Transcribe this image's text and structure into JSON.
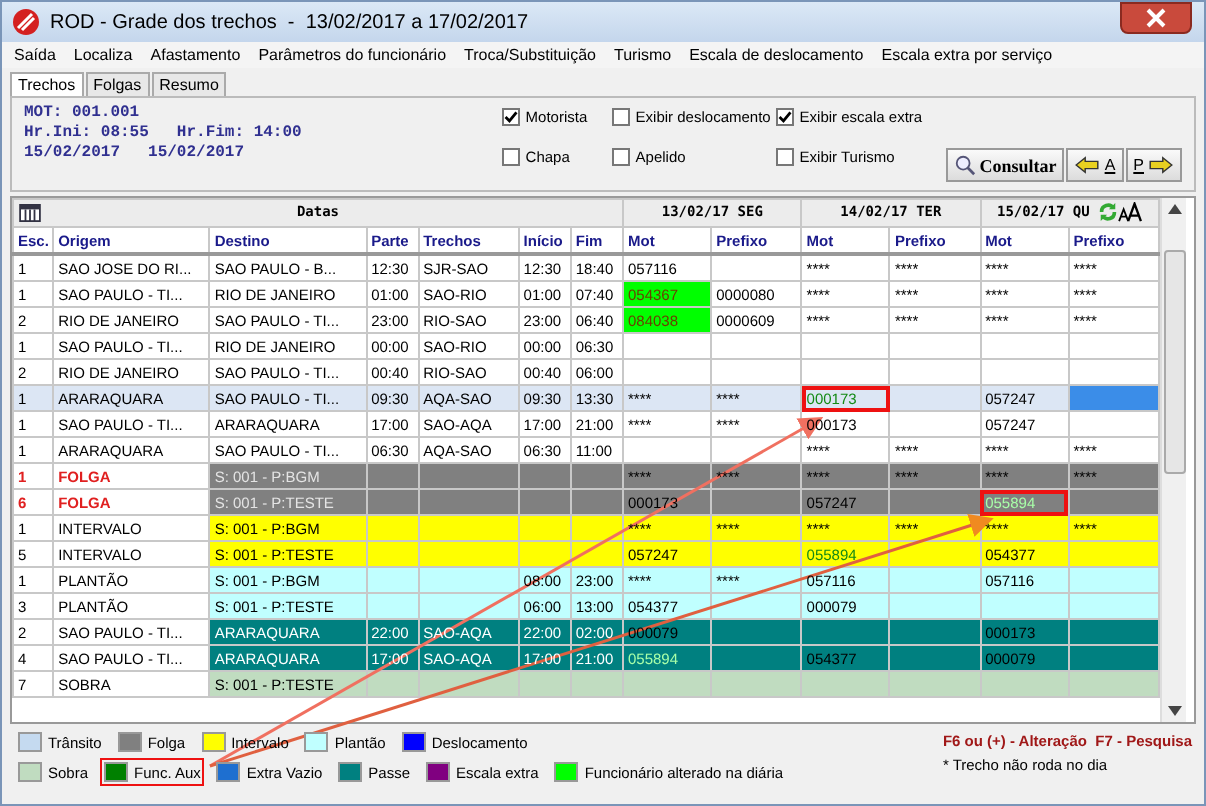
{
  "window": {
    "title": "ROD - Grade dos trechos  -  13/02/2017 a 17/02/2017"
  },
  "menu": [
    "Saída",
    "Localiza",
    "Afastamento",
    "Parâmetros do funcionário",
    "Troca/Substituição",
    "Turismo",
    "Escala de deslocamento",
    "Escala extra por serviço"
  ],
  "tabs": [
    {
      "label": "Trechos",
      "selected": true
    },
    {
      "label": "Folgas",
      "selected": false
    },
    {
      "label": "Resumo",
      "selected": false
    }
  ],
  "info": {
    "lines": [
      [
        "MOT: 001.001"
      ],
      [
        "Hr.Ini: 08:55",
        "Hr.Fim: 14:00"
      ],
      [
        "15/02/2017",
        "15/02/2017"
      ]
    ]
  },
  "options": [
    {
      "label": "Motorista",
      "checked": true
    },
    {
      "label": "Exibir deslocamento",
      "checked": false
    },
    {
      "label": "Exibir escala extra",
      "checked": true
    },
    {
      "label": "Chapa",
      "checked": false
    },
    {
      "label": "Apelido",
      "checked": false
    },
    {
      "label": "Exibir Turismo",
      "checked": false
    }
  ],
  "buttons": {
    "consultar": "Consultar",
    "prev": "A",
    "next": "P"
  },
  "grid": {
    "group_label": "Datas",
    "days": [
      {
        "date": "13/02/17 SEG",
        "columns": [
          "Mot",
          "Prefixo"
        ]
      },
      {
        "date": "14/02/17 TER",
        "columns": [
          "Mot",
          "Prefixo"
        ]
      },
      {
        "date": "15/02/17 QU",
        "columns": [
          "Mot",
          "Prefixo"
        ]
      }
    ],
    "columns": [
      "Esc.",
      "Origem",
      "Destino",
      "Parte",
      "Trechos",
      "Início",
      "Fim"
    ],
    "rows": [
      {
        "kind": "trecho",
        "selected": false,
        "cells": [
          "1",
          "SAO JOSE DO RI...",
          "SAO PAULO - B...",
          "12:30",
          "SJR-SAO",
          "12:30",
          "18:40"
        ],
        "days": [
          {
            "mot": "057116",
            "kind": "normal",
            "marked": false,
            "focused": false
          },
          {
            "mot": "****",
            "prefixo": "****",
            "kind": "normal",
            "marked": false,
            "focused": false
          },
          {
            "mot": "****",
            "prefixo": "****",
            "kind": "normal",
            "marked": false,
            "focused": false
          }
        ]
      },
      {
        "kind": "trecho",
        "selected": false,
        "cells": [
          "1",
          "SAO PAULO - TI...",
          "RIO DE JANEIRO",
          "01:00",
          "SAO-RIO",
          "01:00",
          "07:40"
        ],
        "days": [
          {
            "mot": "054367",
            "prefixo": "0000080",
            "kind": "altered",
            "marked": false,
            "focused": false
          },
          {
            "mot": "****",
            "prefixo": "****",
            "kind": "normal",
            "marked": false,
            "focused": false
          },
          {
            "mot": "****",
            "prefixo": "****",
            "kind": "normal",
            "marked": false,
            "focused": false
          }
        ]
      },
      {
        "kind": "trecho",
        "selected": false,
        "cells": [
          "2",
          "RIO DE JANEIRO",
          "SAO PAULO - TI...",
          "23:00",
          "RIO-SAO",
          "23:00",
          "06:40"
        ],
        "days": [
          {
            "mot": "084038",
            "prefixo": "0000609",
            "kind": "altered",
            "marked": false,
            "focused": false
          },
          {
            "mot": "****",
            "prefixo": "****",
            "kind": "normal",
            "marked": false,
            "focused": false
          },
          {
            "mot": "****",
            "prefixo": "****",
            "kind": "normal",
            "marked": false,
            "focused": false
          }
        ]
      },
      {
        "kind": "trecho",
        "selected": false,
        "cells": [
          "1",
          "SAO PAULO - TI...",
          "RIO DE JANEIRO",
          "00:00",
          "SAO-RIO",
          "00:00",
          "06:30"
        ],
        "days": [
          {
            "kind": "normal",
            "marked": false,
            "focused": false
          },
          {
            "kind": "normal",
            "marked": false,
            "focused": false
          },
          {
            "kind": "normal",
            "marked": false,
            "focused": false
          }
        ]
      },
      {
        "kind": "trecho",
        "selected": false,
        "cells": [
          "2",
          "RIO DE JANEIRO",
          "SAO PAULO - TI...",
          "00:40",
          "RIO-SAO",
          "00:40",
          "06:00"
        ],
        "days": [
          {
            "kind": "normal",
            "marked": false,
            "focused": false
          },
          {
            "kind": "normal",
            "marked": false,
            "focused": false
          },
          {
            "kind": "normal",
            "marked": false,
            "focused": false
          }
        ]
      },
      {
        "kind": "trecho",
        "selected": true,
        "cells": [
          "1",
          "ARARAQUARA",
          "SAO PAULO - TI...",
          "09:30",
          "AQA-SAO",
          "09:30",
          "13:30"
        ],
        "days": [
          {
            "mot": "****",
            "prefixo": "****",
            "kind": "normal",
            "marked": false,
            "focused": false
          },
          {
            "mot": "000173",
            "kind": "aux",
            "marked": true,
            "focused": false
          },
          {
            "mot": "057247",
            "kind": "normal",
            "marked": false,
            "focused": true
          }
        ]
      },
      {
        "kind": "trecho",
        "selected": false,
        "cells": [
          "1",
          "SAO PAULO - TI...",
          "ARARAQUARA",
          "17:00",
          "SAO-AQA",
          "17:00",
          "21:00"
        ],
        "days": [
          {
            "mot": "****",
            "prefixo": "****",
            "kind": "normal",
            "marked": false,
            "focused": false
          },
          {
            "mot": "000173",
            "kind": "normal",
            "marked": false,
            "focused": false
          },
          {
            "mot": "057247",
            "kind": "normal",
            "marked": false,
            "focused": false
          }
        ]
      },
      {
        "kind": "trecho",
        "selected": false,
        "cells": [
          "1",
          "ARARAQUARA",
          "SAO PAULO - TI...",
          "06:30",
          "AQA-SAO",
          "06:30",
          "11:00"
        ],
        "days": [
          {
            "kind": "normal",
            "marked": false,
            "focused": false
          },
          {
            "mot": "****",
            "prefixo": "****",
            "kind": "normal",
            "marked": false,
            "focused": false
          },
          {
            "mot": "****",
            "prefixo": "****",
            "kind": "normal",
            "marked": false,
            "focused": false
          }
        ]
      },
      {
        "kind": "folga",
        "selected": false,
        "cells": [
          "1",
          "FOLGA",
          "S: 001 - P:BGM"
        ],
        "days": [
          {
            "mot": "****",
            "prefixo": "****",
            "kind": "normal",
            "marked": false,
            "focused": false
          },
          {
            "mot": "****",
            "prefixo": "****",
            "kind": "normal",
            "marked": false,
            "focused": false
          },
          {
            "mot": "****",
            "prefixo": "****",
            "kind": "normal",
            "marked": false,
            "focused": false
          }
        ]
      },
      {
        "kind": "folga",
        "selected": false,
        "cells": [
          "6",
          "FOLGA",
          "S: 001 - P:TESTE"
        ],
        "days": [
          {
            "mot": "000173",
            "kind": "normal",
            "marked": false,
            "focused": false
          },
          {
            "mot": "057247",
            "kind": "normal",
            "marked": false,
            "focused": false
          },
          {
            "mot": "055894",
            "kind": "aux",
            "marked": true,
            "focused": false
          }
        ]
      },
      {
        "kind": "intervalo",
        "selected": false,
        "cells": [
          "1",
          "INTERVALO",
          "S: 001 - P:BGM"
        ],
        "days": [
          {
            "mot": "****",
            "prefixo": "****",
            "kind": "normal",
            "marked": false,
            "focused": false
          },
          {
            "mot": "****",
            "prefixo": "****",
            "kind": "normal",
            "marked": false,
            "focused": false
          },
          {
            "mot": "****",
            "prefixo": "****",
            "kind": "normal",
            "marked": false,
            "focused": false
          }
        ]
      },
      {
        "kind": "intervalo",
        "selected": false,
        "cells": [
          "5",
          "INTERVALO",
          "S: 001 - P:TESTE"
        ],
        "days": [
          {
            "mot": "057247",
            "kind": "normal",
            "marked": false,
            "focused": false
          },
          {
            "mot": "055894",
            "kind": "aux",
            "marked": false,
            "focused": false
          },
          {
            "mot": "054377",
            "kind": "normal",
            "marked": false,
            "focused": false
          }
        ]
      },
      {
        "kind": "plantao",
        "selected": false,
        "cells": [
          "1",
          "PLANTÃO",
          "S: 001 - P:BGM",
          "",
          "",
          "08:00",
          "23:00"
        ],
        "days": [
          {
            "mot": "****",
            "prefixo": "****",
            "kind": "normal",
            "marked": false,
            "focused": false
          },
          {
            "mot": "057116",
            "kind": "normal",
            "marked": false,
            "focused": false
          },
          {
            "mot": "057116",
            "kind": "normal",
            "marked": false,
            "focused": false
          }
        ]
      },
      {
        "kind": "plantao",
        "selected": false,
        "cells": [
          "3",
          "PLANTÃO",
          "S: 001 - P:TESTE",
          "",
          "",
          "06:00",
          "13:00"
        ],
        "days": [
          {
            "mot": "054377",
            "kind": "normal",
            "marked": false,
            "focused": false
          },
          {
            "mot": "000079",
            "kind": "normal",
            "marked": false,
            "focused": false
          },
          {
            "kind": "normal",
            "marked": false,
            "focused": false
          }
        ]
      },
      {
        "kind": "passe",
        "selected": false,
        "cells": [
          "2",
          "SAO PAULO - TI...",
          "ARARAQUARA",
          "22:00",
          "SAO-AQA",
          "22:00",
          "02:00"
        ],
        "days": [
          {
            "mot": "000079",
            "kind": "normal",
            "marked": false,
            "focused": false
          },
          {
            "kind": "normal",
            "marked": false,
            "focused": false
          },
          {
            "mot": "000173",
            "kind": "normal",
            "marked": false,
            "focused": false
          }
        ]
      },
      {
        "kind": "passe",
        "selected": false,
        "cells": [
          "4",
          "SAO PAULO - TI...",
          "ARARAQUARA",
          "17:00",
          "SAO-AQA",
          "17:00",
          "21:00"
        ],
        "days": [
          {
            "mot": "055894",
            "kind": "aux",
            "marked": false,
            "focused": false
          },
          {
            "mot": "054377",
            "kind": "normal",
            "marked": false,
            "focused": false
          },
          {
            "mot": "000079",
            "kind": "normal",
            "marked": false,
            "focused": false
          }
        ]
      },
      {
        "kind": "sobra",
        "selected": false,
        "cells": [
          "7",
          "SOBRA",
          "S: 001 - P:TESTE"
        ],
        "days": [
          {
            "kind": "normal",
            "marked": false,
            "focused": false
          },
          {
            "kind": "normal",
            "marked": false,
            "focused": false
          },
          {
            "kind": "normal",
            "marked": false,
            "focused": false
          }
        ]
      }
    ]
  },
  "legend": [
    {
      "label": "Trânsito",
      "color": "#c5daf0",
      "marked": false
    },
    {
      "label": "Folga",
      "color": "#808080",
      "marked": false
    },
    {
      "label": "Intervalo",
      "color": "#ffff00",
      "marked": false
    },
    {
      "label": "Plantão",
      "color": "#c0ffff",
      "marked": false
    },
    {
      "label": "Deslocamento",
      "color": "#0000ff",
      "marked": false
    },
    {
      "label": "Sobra",
      "color": "#c0dcc0",
      "marked": false
    },
    {
      "label": "Func. Aux",
      "color": "#008000",
      "marked": true
    },
    {
      "label": "Extra Vazio",
      "color": "#1e6fd0",
      "marked": false
    },
    {
      "label": "Passe",
      "color": "#008080",
      "marked": false
    },
    {
      "label": "Escala extra",
      "color": "#800080",
      "marked": false
    },
    {
      "label": "Funcionário alterado na diária",
      "color": "#00ff00",
      "marked": false
    }
  ],
  "footer": {
    "keys": "F6 ou (+) - Alteração  F7 - Pesquisa",
    "note": "* Trecho não roda no dia"
  }
}
